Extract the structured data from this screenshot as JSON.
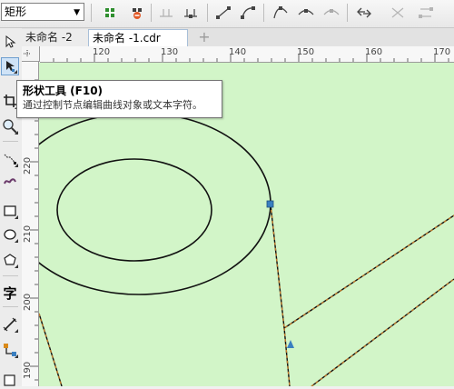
{
  "propbar": {
    "shape_dropdown": {
      "value": "矩形"
    },
    "icons": [
      "add-node-icon",
      "delete-node-icon",
      "join-nodes-icon",
      "break-curve-icon",
      "to-line-icon",
      "to-curve-icon",
      "cusp-node-icon",
      "smooth-node-icon",
      "symmetrical-node-icon",
      "reverse-direction-icon",
      "extend-curve-icon"
    ]
  },
  "tabs": [
    {
      "label": "未命名 -2",
      "active": false
    },
    {
      "label": "未命名 -1.cdr",
      "active": true
    }
  ],
  "ruler": {
    "top_labels": [
      "120",
      "130",
      "140",
      "150",
      "160",
      "170"
    ],
    "left_labels": [
      "220",
      "210",
      "200",
      "190"
    ]
  },
  "tooltip": {
    "title": "形状工具 (F10)",
    "description": "通过控制节点编辑曲线对象或文本字符。"
  },
  "toolbox": {
    "text_tool_label": "字",
    "icons": [
      "pick-tool-icon",
      "shape-tool-icon",
      "crop-tool-icon",
      "zoom-tool-icon",
      "freehand-tool-icon",
      "smart-drawing-icon",
      "rectangle-tool-icon",
      "ellipse-tool-icon",
      "polygon-tool-icon",
      "text-tool-icon",
      "dimension-tool-icon",
      "connector-tool-icon",
      "interactive-tool-icon"
    ]
  },
  "colors": {
    "canvas": "#d2f5c8",
    "curve": "#000000",
    "selected_path": "#c07a2a",
    "node": "#3a7fc0"
  }
}
